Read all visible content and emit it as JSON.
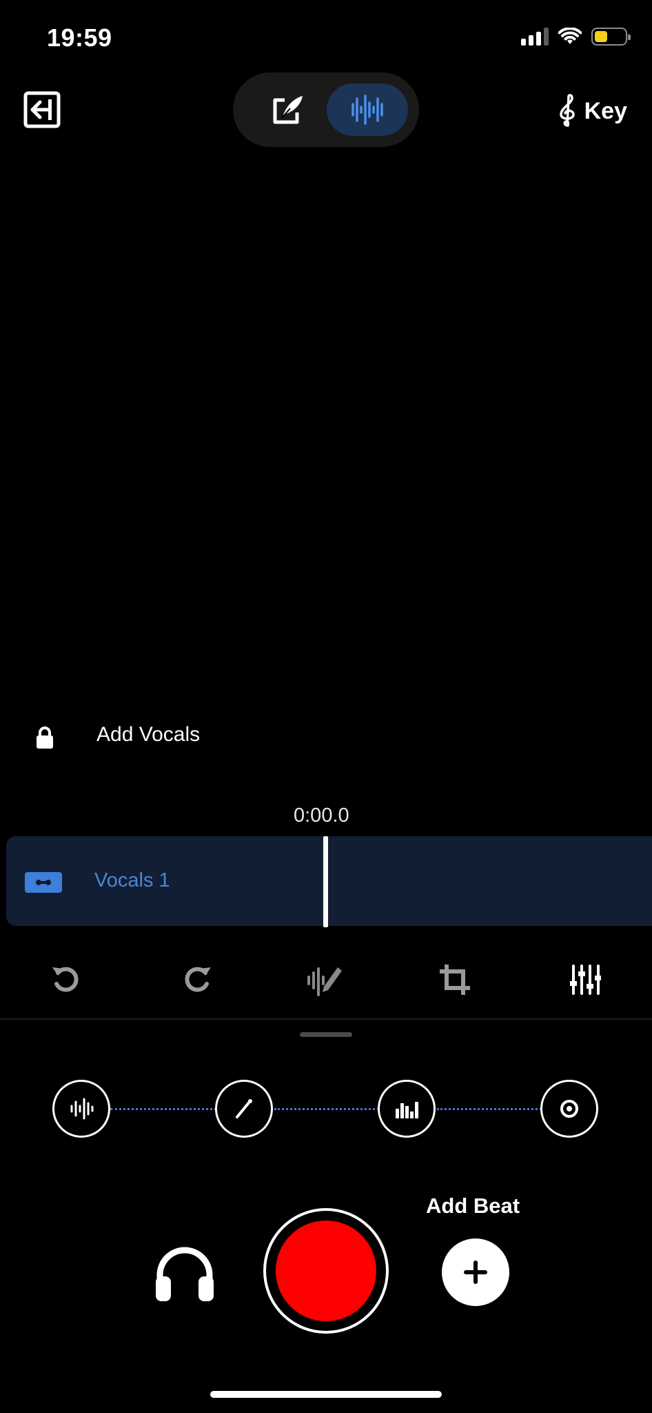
{
  "status_bar": {
    "time": "19:59",
    "icons": [
      "signal-icon",
      "wifi-icon",
      "battery-icon"
    ],
    "battery_color": "#f4d21b"
  },
  "top_bar": {
    "exit_icon": "exit-icon",
    "mode_toggle": {
      "options": [
        {
          "icon": "edit-lyrics-icon",
          "active": false
        },
        {
          "icon": "waveform-icon",
          "active": true
        }
      ]
    },
    "key": {
      "icon": "treble-clef-icon",
      "label": "Key"
    }
  },
  "vocals_lane": {
    "lock_icon": "lock-icon",
    "label": "Add Vocals"
  },
  "timeline": {
    "time": "0:00.0",
    "track": {
      "icon": "cassette-icon",
      "label": "Vocals 1"
    }
  },
  "tools": [
    {
      "name": "undo",
      "icon": "undo-icon"
    },
    {
      "name": "redo",
      "icon": "redo-icon"
    },
    {
      "name": "magic-edit",
      "icon": "magic-wand-icon"
    },
    {
      "name": "crop",
      "icon": "crop-icon"
    },
    {
      "name": "mixer",
      "icon": "sliders-icon"
    }
  ],
  "effect_chain": [
    {
      "icon": "waveform-icon"
    },
    {
      "icon": "slash-icon"
    },
    {
      "icon": "equalizer-icon"
    },
    {
      "icon": "speaker-icon"
    }
  ],
  "bottom_controls": {
    "monitor_icon": "headphones-icon",
    "record_color": "#ff0000",
    "add_beat_label": "Add Beat",
    "add_beat_icon": "plus-icon"
  },
  "colors": {
    "accent": "#3d7fd9",
    "track_bg": "#121e33",
    "active_toggle": "#1c3455"
  }
}
